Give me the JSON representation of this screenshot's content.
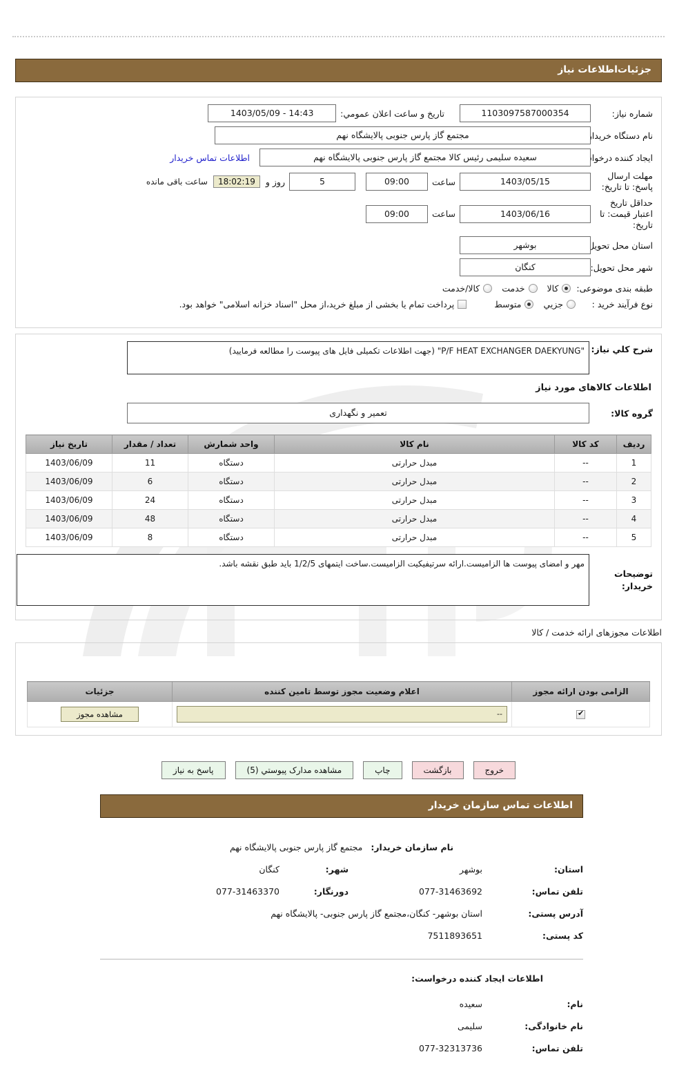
{
  "sections": {
    "need_details_title": "جزئیات‌اطلاعات نیاز",
    "goods_info_title": "اطلاعات کالاهای مورد نیاز",
    "permits_title": "اطلاعات مجوزهای ارائه خدمت / کالا",
    "buyer_contact_title": "اطلاعات تماس سازمان خریدار",
    "creator_title": "اطلاعات ایجاد کننده درخواست:"
  },
  "need": {
    "number_label": "شماره نیاز:",
    "number_value": "1103097587000354",
    "announce_label": "تاریخ و ساعت اعلان عمومي:",
    "announce_value": "1403/05/09 - 14:43",
    "buyer_org_label": "نام دستگاه خریدار:",
    "buyer_org_value": "مجتمع گاز پارس جنوبی پالایشگاه نهم",
    "creator_label": "ایجاد کننده درخواست:",
    "creator_value": "سعیده سلیمی رئیس کالا مجتمع گاز پارس جنوبی پالایشگاه نهم",
    "contact_link": "اطلاعات تماس خریدار",
    "deadline_label": "مهلت ارسال پاسخ: تا تاریخ:",
    "deadline_date": "1403/05/15",
    "hour_label": "ساعت",
    "deadline_time": "09:00",
    "days_value": "5",
    "days_unit": "روز و",
    "countdown": "18:02:19",
    "remaining_label": "ساعت باقی مانده",
    "price_validity_label": "حداقل تاریخ اعتبار قیمت: تا تاریخ:",
    "price_validity_date": "1403/06/16",
    "price_validity_time": "09:00",
    "province_label": "استان محل تحویل:",
    "province_value": "بوشهر",
    "city_label": "شهر محل تحویل:",
    "city_value": "کنگان",
    "category_label": "طبقه بندی موضوعی:",
    "category_options": [
      {
        "label": "کالا",
        "selected": true
      },
      {
        "label": "خدمت",
        "selected": false
      },
      {
        "label": "کالا/خدمت",
        "selected": false
      }
    ],
    "process_label": "نوع فرآیند خرید :",
    "process_options": [
      {
        "label": "جزيي",
        "selected": false
      },
      {
        "label": "متوسط",
        "selected": true
      }
    ],
    "treasury_checkbox_label": "پرداخت تمام یا بخشی از مبلغ خرید،از محل \"اسناد خزانه اسلامی\" خواهد بود.",
    "treasury_checked": false,
    "description_label": "شرح کلي نیاز:",
    "description_value": "\"P/F HEAT  EXCHANGER DAEKYUNG\"  (جهت اطلاعات تکمیلی فایل های پیوست را مطالعه فرمایید)",
    "goods_group_label": "گروه کالا:",
    "goods_group_value": "تعمیر و نگهداری",
    "buyer_notes_label": "توضیحات خریدار:",
    "buyer_notes_value": "مهر و امضای پیوست ها الزامیست.ارائه سرتیفیکیت الزامیست.ساخت ایتمهای 1/2/5 باید طبق نقشه باشد."
  },
  "goods_table": {
    "headers": [
      "ردیف",
      "کد کالا",
      "نام کالا",
      "واحد شمارش",
      "تعداد / مقدار",
      "تاریخ نیاز"
    ],
    "rows": [
      {
        "row": "1",
        "code": "--",
        "name": "مبدل حرارتی",
        "unit": "دستگاه",
        "qty": "11",
        "date": "1403/06/09"
      },
      {
        "row": "2",
        "code": "--",
        "name": "مبدل حرارتی",
        "unit": "دستگاه",
        "qty": "6",
        "date": "1403/06/09"
      },
      {
        "row": "3",
        "code": "--",
        "name": "مبدل حرارتی",
        "unit": "دستگاه",
        "qty": "24",
        "date": "1403/06/09"
      },
      {
        "row": "4",
        "code": "--",
        "name": "مبدل حرارتی",
        "unit": "دستگاه",
        "qty": "48",
        "date": "1403/06/09"
      },
      {
        "row": "5",
        "code": "--",
        "name": "مبدل حرارتی",
        "unit": "دستگاه",
        "qty": "8",
        "date": "1403/06/09"
      }
    ]
  },
  "permit_table": {
    "headers": [
      "الزامی بودن ارائه مجوز",
      "اعلام وضعیت مجوز توسط تامین کننده",
      "جزئیات"
    ],
    "row": {
      "required_checked": true,
      "status_value": "--",
      "details_button": "مشاهده مجوز"
    }
  },
  "actions": [
    {
      "label": "پاسخ به نیاز",
      "style": "green"
    },
    {
      "label": "مشاهده مدارک پیوستي (5)",
      "style": "green"
    },
    {
      "label": "چاپ",
      "style": "green"
    },
    {
      "label": "بازگشت",
      "style": "pink"
    },
    {
      "label": "خروج",
      "style": "pink"
    }
  ],
  "buyer_contact": {
    "org_label": "نام سازمان  خریدار:",
    "org_value": "مجتمع گاز پارس جنوبی  پالایشگاه نهم",
    "province_label": "استان:",
    "province_value": "بوشهر",
    "city_label": "شهر:",
    "city_value": "کنگان",
    "phone_label": "تلفن تماس:",
    "phone_value": "077-31463692",
    "fax_label": "دورنگار:",
    "fax_value": "077-31463370",
    "address_label": "آدرس پستی:",
    "address_value": "استان بوشهر- کنگان،مجتمع گاز پارس جنوبی- پالایشگاه نهم",
    "postal_label": "کد پستی:",
    "postal_value": "7511893651"
  },
  "creator": {
    "first_name_label": "نام:",
    "first_name_value": "سعیده",
    "last_name_label": "نام  خانوادگی:",
    "last_name_value": "سلیمی",
    "phone_label": "تلفن تماس:",
    "phone_value": "077-32313736"
  },
  "colors": {
    "header_bar": "#8a6a3d",
    "link": "#2222cc",
    "green_button": "#e9f6e9",
    "pink_button": "#f7d9dc",
    "permit_field": "#eceacb"
  }
}
